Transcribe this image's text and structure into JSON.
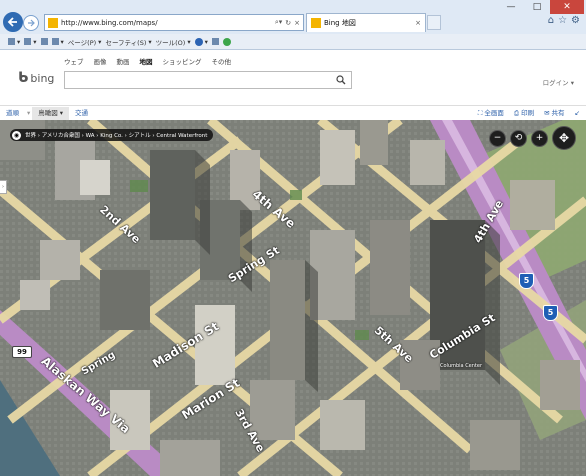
{
  "browser": {
    "address_url": "http://www.bing.com/maps/",
    "tab_title": "Bing 地図",
    "command_bar": {
      "page_menu": "ページ(P)",
      "safety_menu": "セーフティ(S)",
      "tools_menu": "ツール(O)"
    }
  },
  "bing": {
    "logo_text": "bing",
    "scopes": [
      "ウェブ",
      "画像",
      "動画",
      "地図",
      "ショッピング",
      "その他"
    ],
    "active_scope": "地図",
    "search_value": "",
    "login_label": "ログイン"
  },
  "map_toolbar": {
    "directions_label": "道順",
    "view_label": "鳥瞰図",
    "traffic_label": "交通",
    "fullscreen_label": "全画面",
    "print_label": "印刷",
    "share_label": "共有"
  },
  "map": {
    "breadcrumb": "世界 › アメリカ合衆国 › WA › King Co. › シアトル › Central Waterfront",
    "streets": [
      "4th Ave",
      "2nd Ave",
      "Spring St",
      "Madison St",
      "Marion St",
      "3rd Ave",
      "5th Ave",
      "Columbia St",
      "Alaskan Way Via",
      "Spring"
    ],
    "buildings": [
      "Columbia Center"
    ],
    "shields": [
      "5",
      "5",
      "99"
    ],
    "colors": {
      "highway": "#b98bc4",
      "arterial": "#e8d9a5",
      "water": "#4f6f7e",
      "park": "#7fa86a"
    }
  }
}
